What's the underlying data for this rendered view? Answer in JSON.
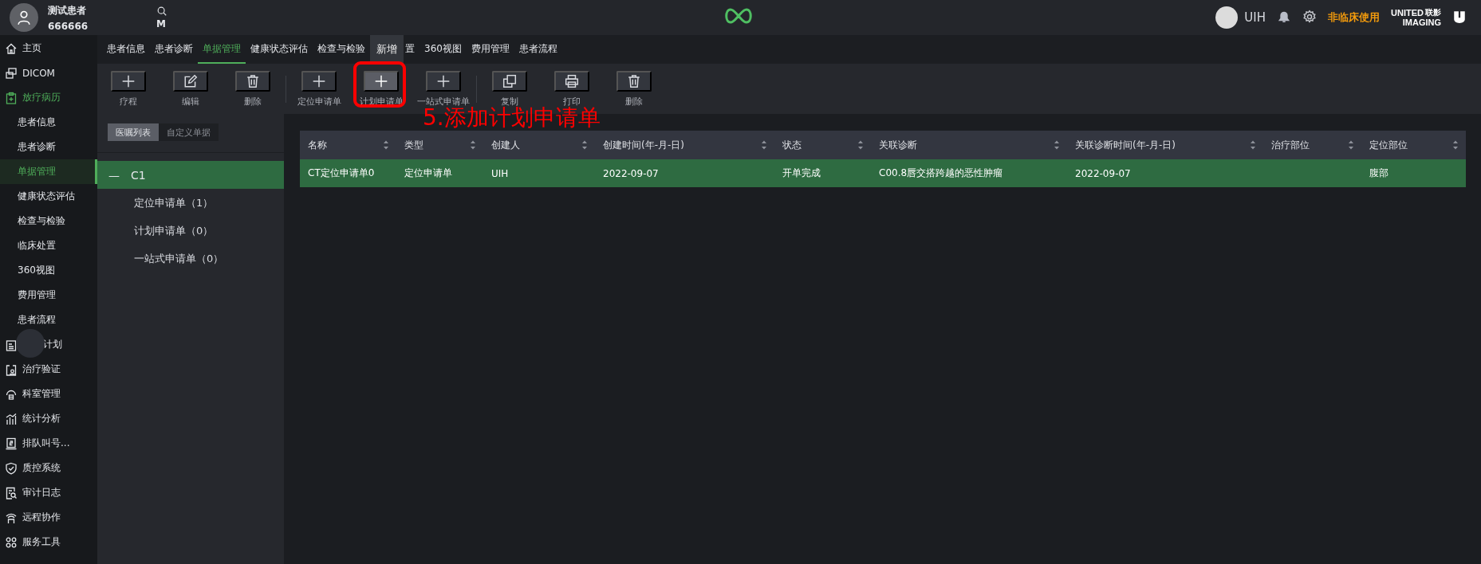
{
  "header": {
    "patient_name": "测试患者",
    "patient_id": "666666",
    "search_label": "M",
    "user": "UIH",
    "mode": "非临床使用",
    "brand_top": "UNITED",
    "brand_cn": "联影",
    "brand_bottom": "IMAGING"
  },
  "sidebar": {
    "items": [
      {
        "label": "主页",
        "kind": "home"
      },
      {
        "label": "DICOM",
        "kind": "dicom"
      },
      {
        "label": "放疗病历",
        "kind": "record",
        "expanded": true,
        "children": [
          {
            "label": "患者信息",
            "selected": false
          },
          {
            "label": "患者诊断",
            "selected": false
          },
          {
            "label": "单据管理",
            "selected": true
          },
          {
            "label": "健康状态评估",
            "selected": false
          },
          {
            "label": "检查与检验",
            "selected": false
          },
          {
            "label": "临床处置",
            "selected": false
          },
          {
            "label": "360视图",
            "selected": false
          },
          {
            "label": "费用管理",
            "selected": false
          },
          {
            "label": "患者流程",
            "selected": false
          }
        ]
      },
      {
        "label": "计划",
        "kind": "plan",
        "covered": true
      },
      {
        "label": "治疗验证",
        "kind": "verify"
      },
      {
        "label": "科室管理",
        "kind": "dept"
      },
      {
        "label": "统计分析",
        "kind": "stats"
      },
      {
        "label": "排队叫号...",
        "kind": "queue"
      },
      {
        "label": "质控系统",
        "kind": "shield"
      },
      {
        "label": "审计日志",
        "kind": "audit"
      },
      {
        "label": "远程协作",
        "kind": "remote"
      },
      {
        "label": "服务工具",
        "kind": "tools"
      }
    ]
  },
  "tabs": [
    {
      "label": "患者信息",
      "selected": false
    },
    {
      "label": "患者诊断",
      "selected": false
    },
    {
      "label": "单据管理",
      "selected": true
    },
    {
      "label": "健康状态评估",
      "selected": false
    },
    {
      "label": "检查与检验",
      "selected": false
    },
    {
      "label": "置",
      "selected": false,
      "tooltip": "新增"
    },
    {
      "label": "360视图",
      "selected": false
    },
    {
      "label": "费用管理",
      "selected": false
    },
    {
      "label": "患者流程",
      "selected": false
    }
  ],
  "toolbar": {
    "groups": [
      [
        {
          "label": "疗程",
          "kind": "add",
          "selected": false
        },
        {
          "label": "编辑",
          "kind": "edit",
          "selected": false
        },
        {
          "label": "删除",
          "kind": "delete",
          "selected": false
        }
      ],
      [
        {
          "label": "定位申请单",
          "kind": "add",
          "selected": false
        },
        {
          "label": "计划申请单",
          "kind": "add",
          "selected": true,
          "annotated": true
        },
        {
          "label": "一站式申请单",
          "kind": "add",
          "selected": false
        }
      ],
      [
        {
          "label": "复制",
          "kind": "copy",
          "selected": false
        },
        {
          "label": "打印",
          "kind": "print",
          "selected": false
        },
        {
          "label": "删除",
          "kind": "delete",
          "selected": false
        }
      ]
    ]
  },
  "annotation": {
    "text": "5.添加计划申请单"
  },
  "left_panel": {
    "segments": [
      {
        "label": "医嘱列表",
        "selected": true
      },
      {
        "label": "自定义单据",
        "selected": false
      }
    ],
    "tree": [
      {
        "label": "C1",
        "expander": "—",
        "selected": true,
        "children": [
          {
            "label": "定位申请单（1）"
          },
          {
            "label": "计划申请单（0）"
          },
          {
            "label": "一站式申请单（0）"
          }
        ]
      }
    ]
  },
  "table": {
    "columns": [
      "名称",
      "类型",
      "创建人",
      "创建时间(年-月-日)",
      "状态",
      "关联诊断",
      "关联诊断时间(年-月-日)",
      "治疗部位",
      "定位部位"
    ],
    "rows": [
      {
        "selected": true,
        "cells": [
          "CT定位申请单0",
          "定位申请单",
          "UIH",
          "2022-09-07",
          "开单完成",
          "C00.8唇交搭跨越的恶性肿瘤",
          "2022-09-07",
          null,
          "腹部"
        ]
      }
    ]
  }
}
